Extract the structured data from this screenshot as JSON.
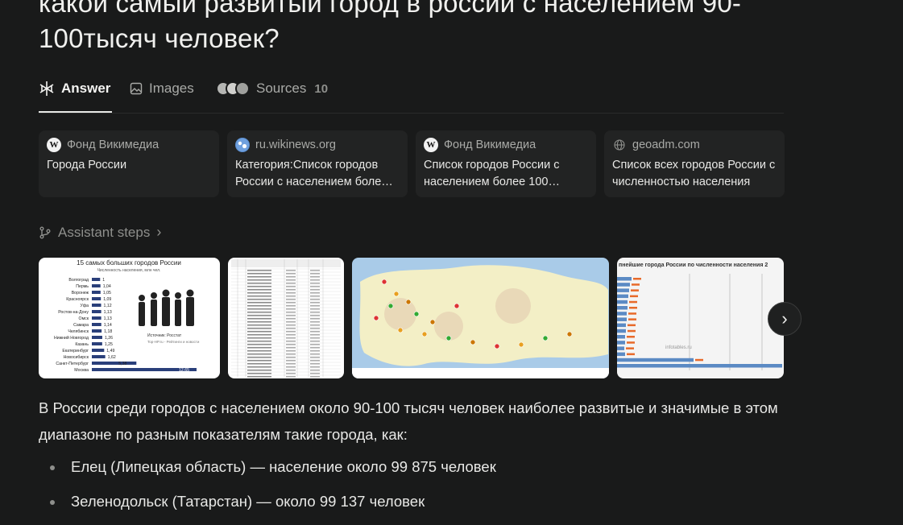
{
  "query": {
    "title": "какой самый развитый город в россии с населением 90-100тысяч человек?"
  },
  "tabs": [
    {
      "label": "Answer",
      "icon": "perplexity-icon"
    },
    {
      "label": "Images",
      "icon": "image-icon"
    },
    {
      "label": "Sources",
      "icon": "source-favicons",
      "count": "10"
    }
  ],
  "source_cards": [
    {
      "site": "Фонд Викимедиа",
      "title": "Города России",
      "favicon": "W"
    },
    {
      "site": "ru.wikinews.org",
      "title": "Категория:Список городов России с населением боле…",
      "favicon": "globe"
    },
    {
      "site": "Фонд Викимедиа",
      "title": "Список городов России с населением более 100…",
      "favicon": "W"
    },
    {
      "site": "geoadm.com",
      "title": "Список всех городов России с численностью населения",
      "favicon": "globe"
    }
  ],
  "assistant_steps": {
    "label": "Assistant steps"
  },
  "images": {
    "chart1": {
      "title": "15 самых больших городов России",
      "subtitle": "Численность населения, млн чел.",
      "source": "Источник: Росстат",
      "site": "Top-HP.ru - Рейтинги и новости",
      "rows": [
        {
          "city": "Волгоград",
          "value": "1"
        },
        {
          "city": "Пермь",
          "value": "1,04"
        },
        {
          "city": "Воронеж",
          "value": "1,05"
        },
        {
          "city": "Красноярск",
          "value": "1,09"
        },
        {
          "city": "Уфа",
          "value": "1,12"
        },
        {
          "city": "Ростов-на-Дону",
          "value": "1,13"
        },
        {
          "city": "Омск",
          "value": "1,13"
        },
        {
          "city": "Самара",
          "value": "1,14"
        },
        {
          "city": "Челябинск",
          "value": "1,18"
        },
        {
          "city": "Нижний Новгород",
          "value": "1,26"
        },
        {
          "city": "Казань",
          "value": "1,25"
        },
        {
          "city": "Екатеринбург",
          "value": "1,49"
        },
        {
          "city": "Новосибирск",
          "value": "1,62"
        },
        {
          "city": "Санкт-Петербург",
          "value": "5,38"
        },
        {
          "city": "Москва",
          "value": "12,65"
        }
      ]
    },
    "chart4": {
      "title": "пнейшие города России по численности населения 2",
      "watermark": "infotables.ru"
    }
  },
  "answer": {
    "intro": "В России среди городов с населением около 90-100 тысяч человек наиболее развитые и значимые в этом диапазоне по разным показателям такие города, как:",
    "items": [
      "Елец (Липецкая область) — население около 99 875 человек",
      "Зеленодольск (Татарстан) — около 99 137 человек"
    ]
  }
}
